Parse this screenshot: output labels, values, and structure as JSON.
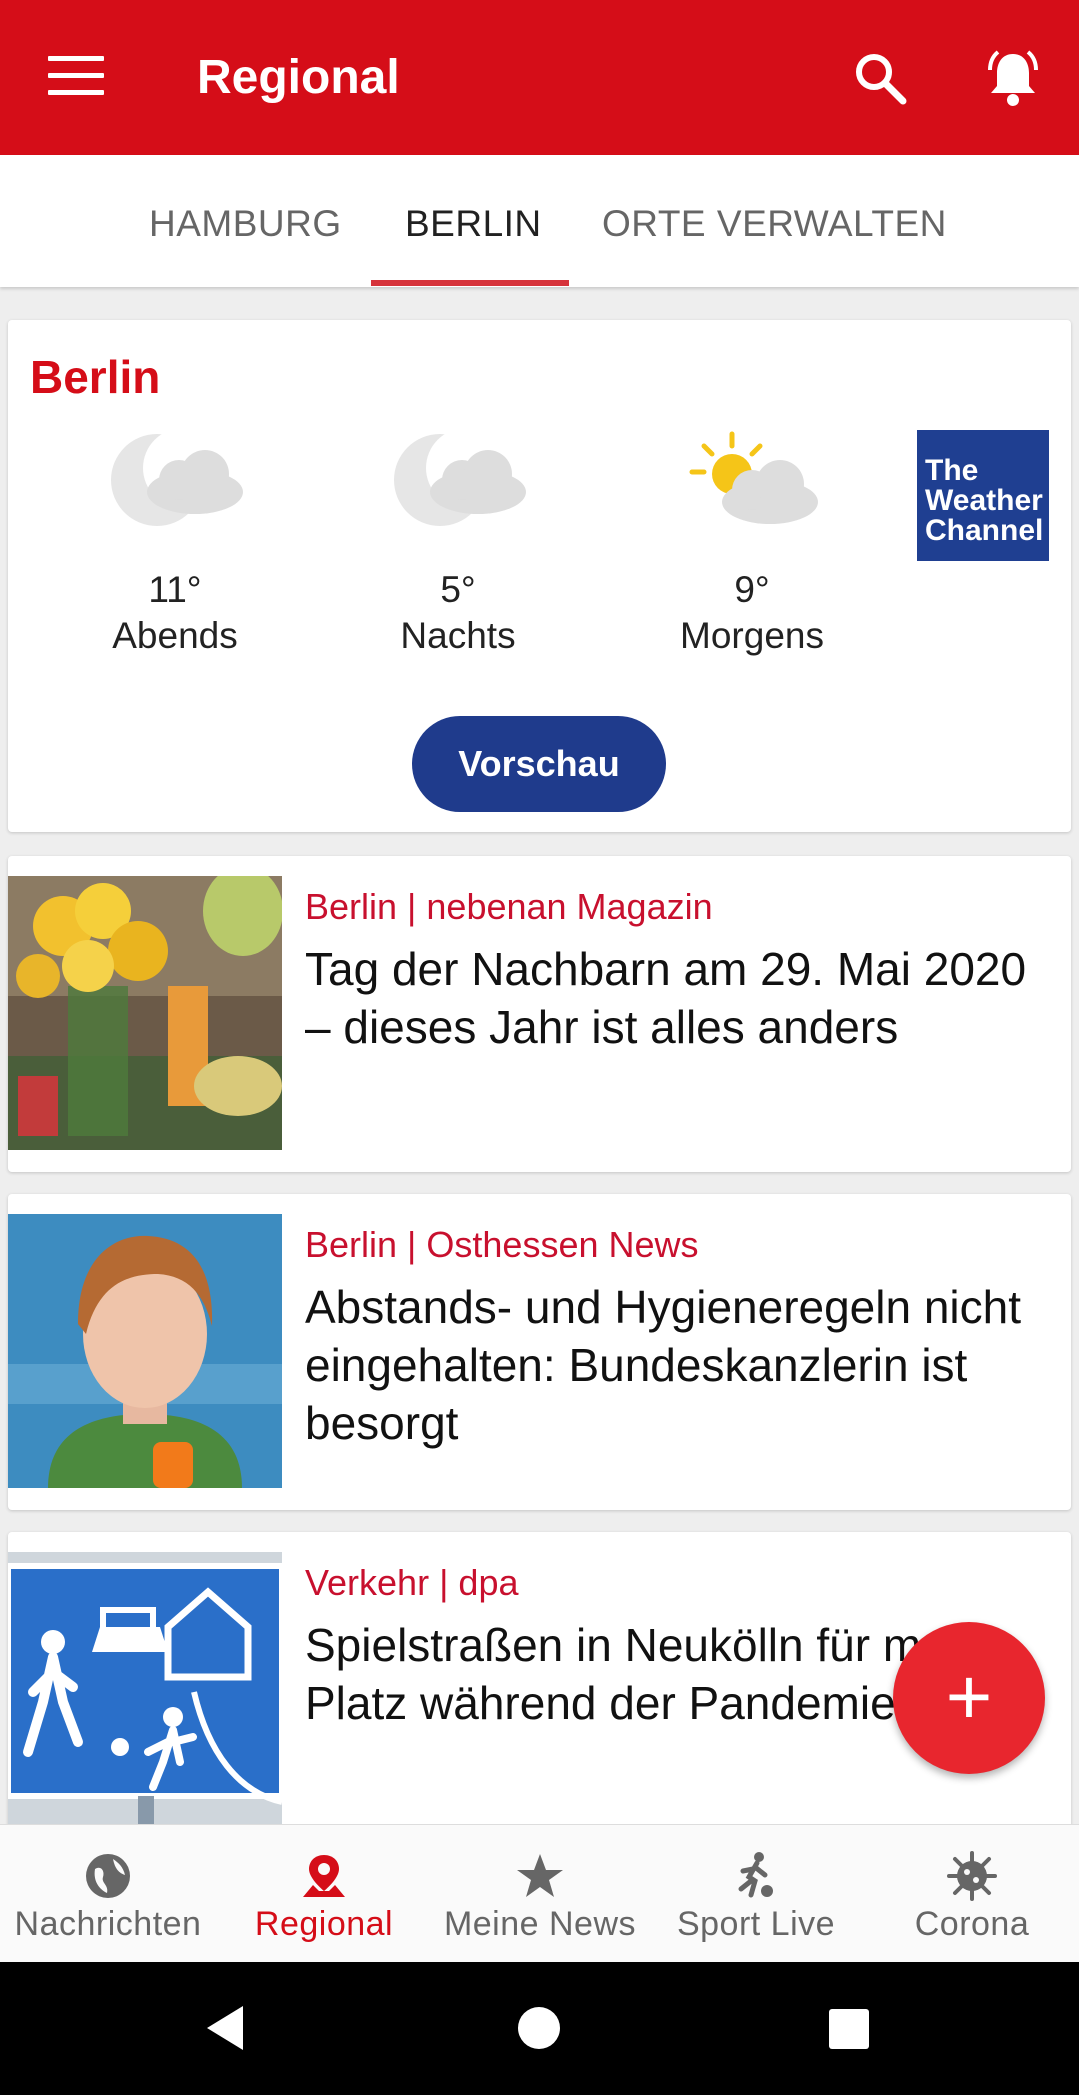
{
  "appbar": {
    "title": "Regional",
    "menu_icon": "hamburger-menu-icon",
    "search_icon": "search-icon",
    "bell_icon": "notification-bell-icon",
    "color": "#d50d18"
  },
  "tabs": [
    {
      "label": "HAMBURG",
      "active": false
    },
    {
      "label": "BERLIN",
      "active": true
    },
    {
      "label": "ORTE VERWALTEN",
      "active": false
    }
  ],
  "weather": {
    "city": "Berlin",
    "items": [
      {
        "temp": "11°",
        "label": "Abends",
        "icon": "moon-cloud-icon"
      },
      {
        "temp": "5°",
        "label": "Nachts",
        "icon": "moon-cloud-icon"
      },
      {
        "temp": "9°",
        "label": "Morgens",
        "icon": "sun-cloud-icon"
      }
    ],
    "provider_logo": {
      "line1": "The",
      "line2": "Weather",
      "line3": "Channel"
    },
    "preview_button": "Vorschau"
  },
  "articles": [
    {
      "meta": "Berlin | nebenan Magazin",
      "headline": "Tag der Nachbarn am 29. Mai 2020 – dieses Jahr ist alles anders"
    },
    {
      "meta": "Berlin | Osthessen News",
      "headline": "Abstands- und Hygieneregeln nicht eingehalten: Bundeskanzlerin ist besorgt"
    },
    {
      "meta": "Verkehr | dpa",
      "headline": "Spielstraßen in Neukölln für mehr Platz während der Pandemie"
    }
  ],
  "fab": {
    "label": "+",
    "icon": "add-icon"
  },
  "bottom_nav": [
    {
      "label": "Nachrichten",
      "icon": "globe-icon",
      "active": false
    },
    {
      "label": "Regional",
      "icon": "location-pin-icon",
      "active": true
    },
    {
      "label": "Meine News",
      "icon": "star-icon",
      "active": false
    },
    {
      "label": "Sport Live",
      "icon": "soccer-player-icon",
      "active": false
    },
    {
      "label": "Corona",
      "icon": "virus-icon",
      "active": false
    }
  ],
  "system_nav": [
    "back-icon",
    "home-icon",
    "recents-icon"
  ]
}
